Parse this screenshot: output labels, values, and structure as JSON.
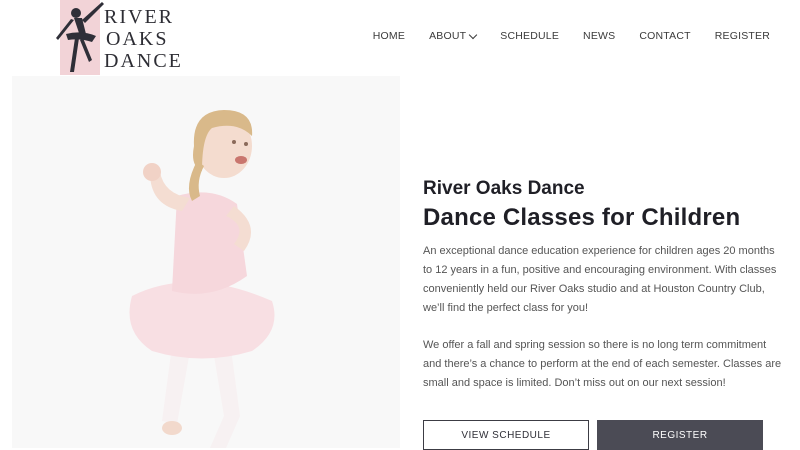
{
  "brand": {
    "logo_lines": [
      "RIVER",
      "OAKS",
      "DANCE"
    ],
    "logo_bg": "#f2d3d7",
    "logo_ink": "#2d2d34"
  },
  "nav": {
    "items": [
      {
        "label": "HOME"
      },
      {
        "label": "ABOUT",
        "has_dropdown": true
      },
      {
        "label": "SCHEDULE"
      },
      {
        "label": "NEWS"
      },
      {
        "label": "CONTACT"
      },
      {
        "label": "REGISTER"
      }
    ]
  },
  "hero": {
    "subtitle": "River Oaks Dance",
    "title": "Dance Classes for Children",
    "paragraphs": [
      "An exceptional dance education experience for children ages 20 months to 12 years in a fun, positive and encouraging environment. With classes conveniently held our River Oaks studio and at Houston Country Club, we’ll find the perfect class for you!",
      "We offer a fall and spring session so there is no long term commitment and there’s a chance to perform at the end of each semester. Classes are small and space is limited. Don’t miss out on our next session!"
    ],
    "buttons": {
      "schedule_label": "VIEW SCHEDULE",
      "register_label": "REGISTER"
    }
  },
  "colors": {
    "dark_button": "#4b4b55",
    "text": "#1f1f26",
    "leotard": "#f6d7dc"
  }
}
